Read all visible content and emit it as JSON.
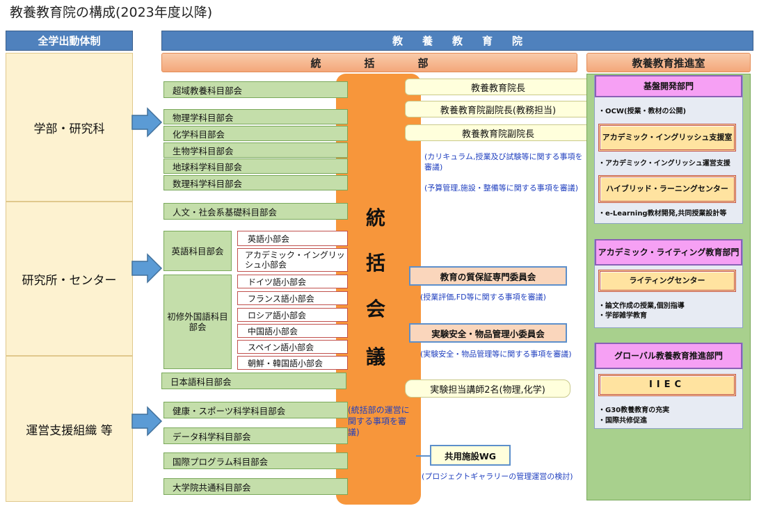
{
  "title": "教養教育院の構成(2023年度以降)",
  "left": {
    "header": "全学出動体制",
    "blocks": [
      "学部・研究科",
      "研究所・センター",
      "運営支援組織 等"
    ]
  },
  "main_header": "教養教育院",
  "tokatsu_header": "統括部",
  "suishin_header": "教養教育推進室",
  "committees_col1": [
    "超域教養科目部会",
    "物理学科目部会",
    "化学科目部会",
    "生物学科目部会",
    "地球科学科目部会",
    "数理科学科目部会",
    "人文・社会系基礎科目部会"
  ],
  "eigo_bukai": "英語科目部会",
  "eigo_subs": [
    "英語小部会",
    "アカデミック・イングリッシュ小部会"
  ],
  "shoshu_bukai": "初修外国語科目部会",
  "shoshu_subs": [
    "ドイツ語小部会",
    "フランス語小部会",
    "ロシア語小部会",
    "中国語小部会",
    "スペイン語小部会",
    "朝鮮・韓国語小部会"
  ],
  "committees_col1_lower": [
    "日本語科目部会",
    "健康・スポーツ科学科目部会",
    "データ科学科目部会",
    "国際プログラム科目部会",
    "大学院共通科目部会"
  ],
  "kaigi_chars": [
    "統",
    "括",
    "会",
    "議"
  ],
  "kaigi_note": "(統括部の運営に関する事項を審議)",
  "officers": [
    "教養教育院長",
    "教養教育院副院長(教務担当)",
    "教養教育院副院長"
  ],
  "officer_notes": [
    "(カリキュラム,授業及び試験等に関する事項を審議)",
    "(予算管理,施設・整備等に関する事項を審議)"
  ],
  "quality_committee": "教育の質保証専門委員会",
  "quality_note": "(授業評価,FD等に関する事項を審議)",
  "safety_committee": "実験安全・物品管理小委員会",
  "safety_note": "(実験安全・物品管理等に関する事項を審議)",
  "lecturers": "実験担当講師2名(物理,化学)",
  "wg": "共用施設WG",
  "wg_note": "(プロジェクトギャラリーの管理運営の検討)",
  "dept1": {
    "name": "基盤開発部門",
    "bullet1": "・OCW(授業・教材の公開)",
    "box1": "アカデミック・イングリッシュ支援室",
    "bullet2": "・アカデミック・イングリッシュ運営支援",
    "box2": "ハイブリッド・ラーニングセンター",
    "bullet3": "・e-Learning教材開発,共同授業設計等"
  },
  "dept2": {
    "name": "アカデミック・ライティング教育部門",
    "box1": "ライティングセンター",
    "bullet1": "・論文作成の授業,個別指導",
    "bullet2": "・学部雑学教育"
  },
  "dept3": {
    "name": "グローバル教養教育推進部門",
    "box1": "IIEC",
    "bullet1": "・G30教養教育の充実",
    "bullet2": "・国際共修促進"
  },
  "colors": {
    "header_blue": "#4F81BD",
    "orange": "#F7963B",
    "green": "#C4DEAA",
    "side_yellow": "#FDF2D0",
    "note_blue": "#1F3FBF"
  }
}
